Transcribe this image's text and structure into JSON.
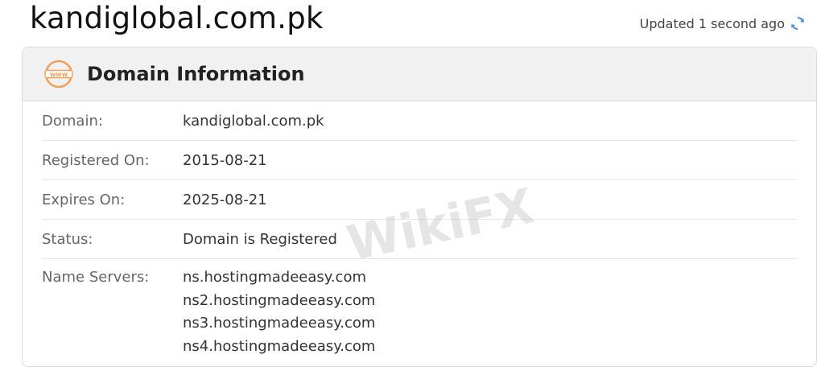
{
  "header": {
    "domain_title": "kandiglobal.com.pk",
    "updated_text": "Updated 1 second ago",
    "refresh_icon": "refresh-icon"
  },
  "card": {
    "title": "Domain Information",
    "icon": "www-icon",
    "icon_text": "www",
    "rows": [
      {
        "label": "Domain:",
        "value": "kandiglobal.com.pk"
      },
      {
        "label": "Registered On:",
        "value": "2015-08-21"
      },
      {
        "label": "Expires On:",
        "value": "2025-08-21"
      },
      {
        "label": "Status:",
        "value": "Domain is Registered"
      }
    ],
    "name_servers": {
      "label": "Name Servers:",
      "values": [
        "ns.hostingmadeeasy.com",
        "ns2.hostingmadeeasy.com",
        "ns3.hostingmadeeasy.com",
        "ns4.hostingmadeeasy.com"
      ]
    }
  },
  "colors": {
    "accent_orange": "#f0a05a",
    "refresh_blue": "#4a90d9"
  },
  "watermark": {
    "text": "WikiFX"
  }
}
